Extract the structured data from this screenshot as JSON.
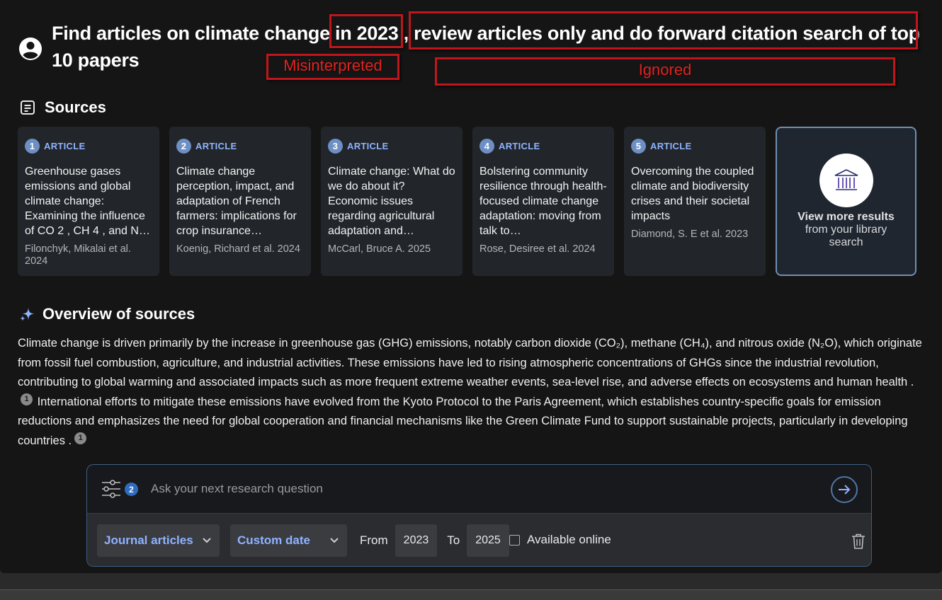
{
  "question": {
    "text": "Find articles on climate change in 2023 , review articles only and do forward citation search of top 10 papers"
  },
  "annotations": {
    "misinterpreted": "Misinterpreted",
    "ignored": "Ignored"
  },
  "sources": {
    "heading": "Sources",
    "cards": [
      {
        "num": "1",
        "tag": "ARTICLE",
        "title": "Greenhouse gases emissions and global climate change: Examining the influence of CO 2 , CH 4 , and N …",
        "meta": "Filonchyk, Mikalai et al. 2024"
      },
      {
        "num": "2",
        "tag": "ARTICLE",
        "title": "Climate change perception, impact, and adaptation of French farmers: implications for crop insurance…",
        "meta": "Koenig, Richard et al. 2024"
      },
      {
        "num": "3",
        "tag": "ARTICLE",
        "title": "Climate change: What do we do about it? Economic issues regarding agricultural adaptation and…",
        "meta": "McCarl, Bruce A. 2025"
      },
      {
        "num": "4",
        "tag": "ARTICLE",
        "title": "Bolstering community resilience through health-focused climate change adaptation: moving from talk to…",
        "meta": "Rose, Desiree et al. 2024"
      },
      {
        "num": "5",
        "tag": "ARTICLE",
        "title": "Overcoming the coupled climate and biodiversity crises and their societal impacts",
        "meta": "Diamond, S. E et al. 2023"
      }
    ],
    "more": {
      "title": "View more results",
      "subtitle": "from your library search"
    }
  },
  "overview": {
    "heading": "Overview of sources",
    "part1": "Climate change is driven primarily by the increase in greenhouse gas (GHG) emissions, notably carbon dioxide (CO₂), methane (CH₄), and nitrous oxide (N₂O), which originate from fossil fuel combustion, agriculture, and industrial activities. These emissions have led to rising atmospheric concentrations of GHGs since the industrial revolution, contributing to global warming and associated impacts such as more frequent extreme weather events, sea-level rise, and adverse effects on ecosystems and human health .",
    "cite1": "1",
    "part2": "International efforts to mitigate these emissions have evolved from the Kyoto Protocol to the Paris Agreement, which establishes country-specific goals for emission reductions and emphasizes the need for global cooperation and financial mechanisms like the Green Climate Fund to support sustainable projects, particularly in developing countries .",
    "cite2": "1"
  },
  "search": {
    "filter_count": "2",
    "placeholder": "Ask your next research question",
    "type_select": "Journal articles",
    "date_select": "Custom date",
    "from_label": "From",
    "from_value": "2023",
    "to_label": "To",
    "to_value": "2025",
    "online_label": "Available online"
  },
  "colors": {
    "accent": "#8fb3ff",
    "annotation_red": "#c0161b",
    "badge": "#6d8fc4"
  }
}
